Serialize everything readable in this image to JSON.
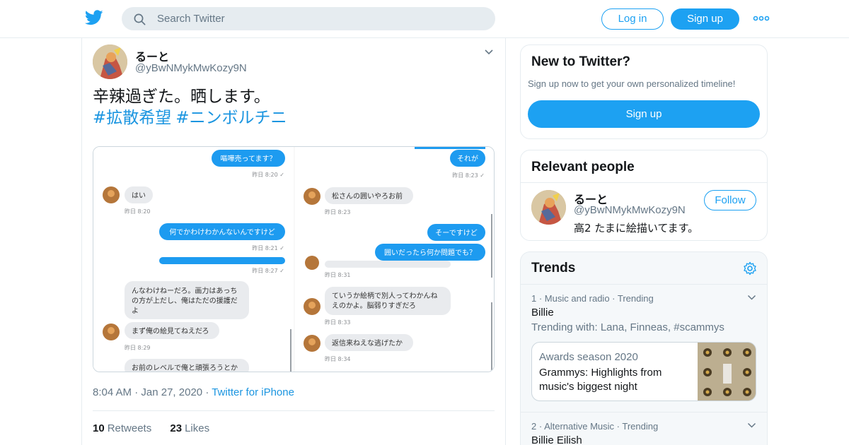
{
  "header": {
    "search_placeholder": "Search Twitter",
    "login_label": "Log in",
    "signup_label": "Sign up",
    "brand_color": "#1da1f2"
  },
  "tweet": {
    "display_name": "るーと",
    "handle": "@yBwNMykMwKozy9N",
    "text": "辛辣過ぎた。晒します。",
    "hashtags": [
      "#拡散希望",
      "#ニンボルチニ"
    ],
    "time": "8:04 AM",
    "date": "Jan 27, 2020",
    "source": "Twitter for iPhone",
    "retweets_count": "10",
    "retweets_label": "Retweets",
    "likes_count": "23",
    "likes_label": "Likes"
  },
  "screenshot_chat": {
    "left": [
      {
        "text": "嘔嘩売ってます？",
        "side": "right",
        "time": "昨日 8:20 ✓"
      },
      {
        "text": "はい",
        "side": "left",
        "time": "昨日 8:20"
      },
      {
        "text": "何でかわけわかんないんですけど",
        "side": "right",
        "time": "昨日 8:21 ✓"
      },
      {
        "text": "",
        "side": "right",
        "time": "昨日 8:27 ✓"
      },
      {
        "text": "んなわけねーだろ。画力はあっちの方が上だし、俺はただの援護だよ",
        "side": "left",
        "time": ""
      },
      {
        "text": "まず俺の絵見てねえだろ",
        "side": "left",
        "time": "昨日 8:29"
      },
      {
        "text": "お前のレベルで俺と頑張ろうとか",
        "side": "left",
        "time": ""
      }
    ],
    "right": [
      {
        "text": "それが",
        "side": "right",
        "time": "昨日 8:23 ✓"
      },
      {
        "text": "松さんの囲いやろお前",
        "side": "left",
        "time": "昨日 8:23"
      },
      {
        "text": "そーですけど",
        "side": "right",
        "time": ""
      },
      {
        "text": "囲いだったら何か問題でも？",
        "side": "right",
        "time": ""
      },
      {
        "text": "",
        "side": "left",
        "time": "昨日 8:31"
      },
      {
        "text": "ていうか絵柄で別人ってわかんねえのかよ。脳弱りすぎだろ",
        "side": "left",
        "time": "昨日 8:33"
      },
      {
        "text": "返信来ねえな逃げたか",
        "side": "left",
        "time": "昨日 8:34"
      }
    ]
  },
  "sidebar": {
    "new_title": "New to Twitter?",
    "new_desc": "Sign up now to get your own personalized timeline!",
    "new_signup": "Sign up",
    "relevant_title": "Relevant people",
    "person_name": "るーと",
    "person_handle": "@yBwNMykMwKozy9N",
    "person_bio": "高2 たまに絵描いてます。",
    "follow_label": "Follow",
    "trends_title": "Trends",
    "trends": [
      {
        "meta": "1 · Music and radio · Trending",
        "name": "Billie",
        "with": "Trending with: Lana, Finneas, #scammys"
      },
      {
        "meta": "2 · Alternative Music · Trending",
        "name": "Billie Eilish",
        "with": ""
      }
    ],
    "moment_category": "Awards season 2020",
    "moment_headline": "Grammys: Highlights from music's biggest night"
  }
}
